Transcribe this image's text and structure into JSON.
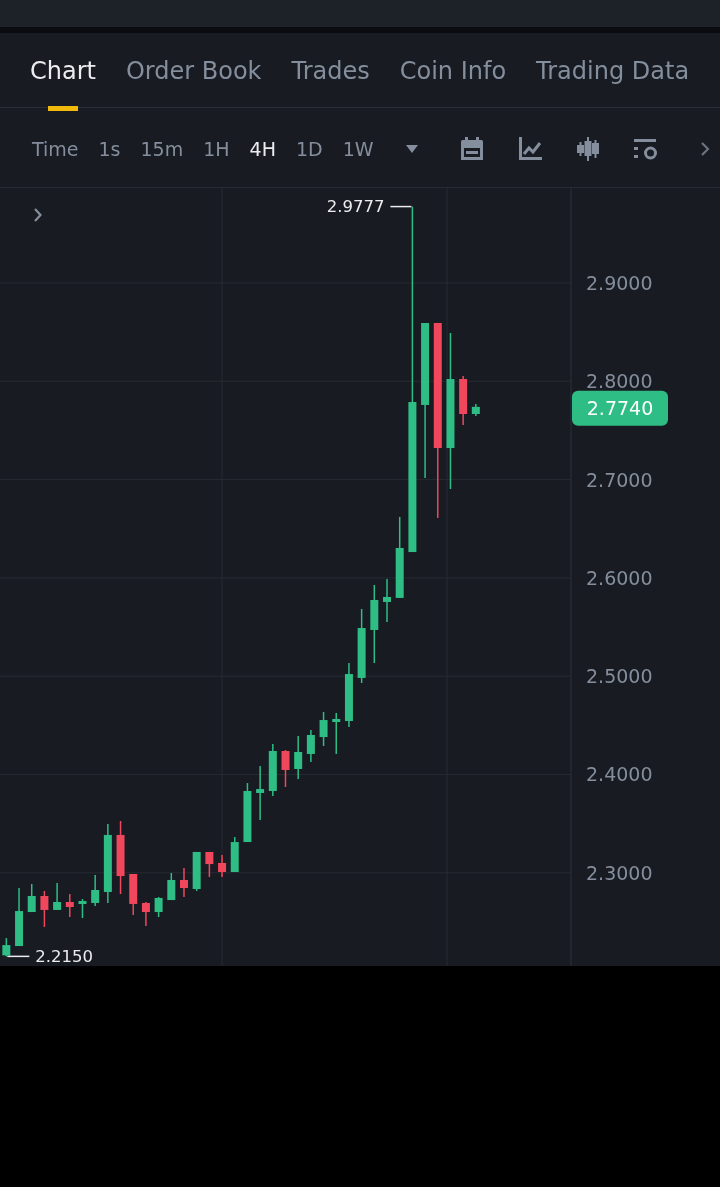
{
  "tabs": [
    {
      "label": "Chart",
      "selected": true
    },
    {
      "label": "Order Book",
      "selected": false
    },
    {
      "label": "Trades",
      "selected": false
    },
    {
      "label": "Coin Info",
      "selected": false
    },
    {
      "label": "Trading Data",
      "selected": false
    }
  ],
  "toolbar": {
    "intervals": [
      {
        "label": "Time",
        "selected": false
      },
      {
        "label": "1s",
        "selected": false
      },
      {
        "label": "15m",
        "selected": false
      },
      {
        "label": "1H",
        "selected": false
      },
      {
        "label": "4H",
        "selected": true
      },
      {
        "label": "1D",
        "selected": false
      },
      {
        "label": "1W",
        "selected": false
      }
    ]
  },
  "chart": {
    "chart_data": {
      "type": "candlestick",
      "grid": true,
      "categories": [
        null,
        null,
        null,
        null,
        null,
        null,
        null,
        null,
        null,
        null,
        null,
        null,
        null,
        null,
        null,
        null,
        null,
        null,
        null,
        null,
        null,
        null,
        null,
        null,
        null,
        null,
        null,
        null,
        null,
        null,
        null,
        null,
        null,
        null,
        null,
        null,
        null,
        null,
        null,
        null,
        null,
        null,
        null,
        null,
        null
      ],
      "ohlc": [
        [
          2.216,
          2.2337,
          2.215,
          2.2265
        ],
        [
          2.2255,
          2.2845,
          2.2255,
          2.2611
        ],
        [
          2.2601,
          2.2886,
          2.2601,
          2.2764
        ],
        [
          2.2764,
          2.2815,
          2.2449,
          2.2622
        ],
        [
          2.2622,
          2.2896,
          2.2622,
          2.2703
        ],
        [
          2.2703,
          2.2784,
          2.255,
          2.2652
        ],
        [
          2.2683,
          2.2733,
          2.254,
          2.2713
        ],
        [
          2.2693,
          2.2978,
          2.2662,
          2.2825
        ],
        [
          2.2805,
          2.3496,
          2.2693,
          2.3385
        ],
        [
          2.3385,
          2.3527,
          2.2784,
          2.2967
        ],
        [
          2.2988,
          2.2988,
          2.2571,
          2.2683
        ],
        [
          2.2693,
          2.2703,
          2.2459,
          2.2601
        ],
        [
          2.2601,
          2.2754,
          2.255,
          2.2744
        ],
        [
          2.2723,
          2.2998,
          2.2723,
          2.2927
        ],
        [
          2.2927,
          2.3049,
          2.2754,
          2.2845
        ],
        [
          2.2835,
          2.3212,
          2.2815,
          2.3212
        ],
        [
          2.3212,
          2.3212,
          2.2957,
          2.3089
        ],
        [
          2.31,
          2.3181,
          2.2957,
          2.3008
        ],
        [
          2.3008,
          2.3364,
          2.3008,
          2.3313
        ],
        [
          2.3313,
          2.3913,
          2.3313,
          2.3832
        ],
        [
          2.3812,
          2.4086,
          2.3537,
          2.3852
        ],
        [
          2.3832,
          2.431,
          2.3781,
          2.4239
        ],
        [
          2.4239,
          2.4249,
          2.3873,
          2.4046
        ],
        [
          2.4056,
          2.4392,
          2.3954,
          2.4229
        ],
        [
          2.4209,
          2.4453,
          2.4127,
          2.4402
        ],
        [
          2.4381,
          2.4636,
          2.429,
          2.4554
        ],
        [
          2.4534,
          2.4626,
          2.4209,
          2.4565
        ],
        [
          2.4544,
          2.5134,
          2.4483,
          2.5022
        ],
        [
          2.4982,
          2.5684,
          2.4931,
          2.549
        ],
        [
          2.547,
          2.5928,
          2.5134,
          2.5775
        ],
        [
          2.5755,
          2.5989,
          2.5551,
          2.5806
        ],
        [
          2.5796,
          2.662,
          2.5796,
          2.6304
        ],
        [
          2.6263,
          2.9777,
          2.6263,
          2.7789
        ],
        [
          2.7759,
          2.8593,
          2.7016,
          2.8593
        ],
        [
          2.8593,
          2.8593,
          2.6609,
          2.7321
        ],
        [
          2.7321,
          2.8491,
          2.6904,
          2.8023
        ],
        [
          2.8023,
          2.8054,
          2.7555,
          2.7667
        ],
        [
          2.7667,
          2.7769,
          2.7647,
          2.774
        ],
        null,
        null,
        null,
        null,
        null,
        null,
        null
      ],
      "ylim": [
        2.2052,
        2.9966
      ],
      "yticks": [
        {
          "value": 2.9,
          "label": "2.9000"
        },
        {
          "value": 2.8,
          "label": "2.8000"
        },
        {
          "value": 2.7,
          "label": "2.7000"
        },
        {
          "value": 2.6,
          "label": "2.6000"
        },
        {
          "value": 2.5,
          "label": "2.5000"
        },
        {
          "value": 2.4,
          "label": "2.4000"
        },
        {
          "value": 2.3,
          "label": "2.3000"
        }
      ],
      "annotations": [
        "2.9777",
        "2.2150",
        "2.7740"
      ]
    }
  }
}
